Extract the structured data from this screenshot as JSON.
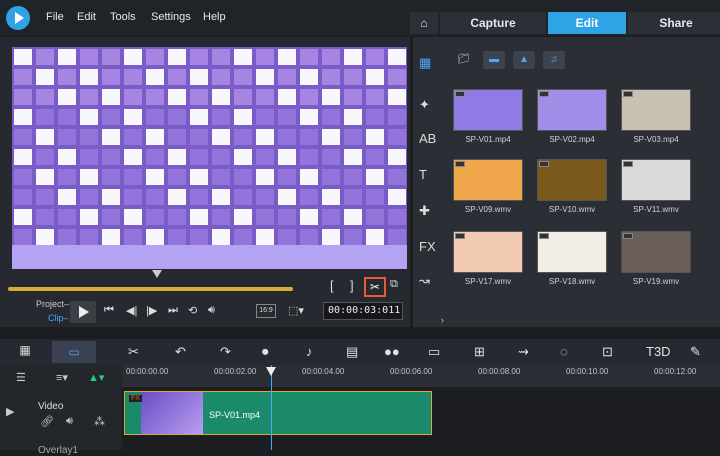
{
  "menu": [
    "File",
    "Edit",
    "Tools",
    "Settings",
    "Help"
  ],
  "tabs": [
    {
      "label": "Capture",
      "active": false
    },
    {
      "label": "Edit",
      "active": true
    },
    {
      "label": "Share",
      "active": false
    }
  ],
  "player": {
    "project_label": "Project–",
    "clip_label": "Clip–",
    "timecode": "00:00:03:011",
    "aspect_ratio": "16:9",
    "mark_in": "[",
    "mark_out": "]"
  },
  "library": {
    "items": [
      {
        "name": "SP-V01.mp4",
        "color": "#8f7be3"
      },
      {
        "name": "SP-V02.mp4",
        "color": "#a18ee8"
      },
      {
        "name": "SP-V03.mp4",
        "color": "#c8c0b0"
      },
      {
        "name": "SP-V09.wmv",
        "color": "#f0a64b"
      },
      {
        "name": "SP-V10.wmv",
        "color": "#7a5a1c"
      },
      {
        "name": "SP-V11.wmv",
        "color": "#d9d9d9"
      },
      {
        "name": "SP-V17.wmv",
        "color": "#f2c9b3"
      },
      {
        "name": "SP-V18.wmv",
        "color": "#f4efe6"
      },
      {
        "name": "SP-V19.wmv",
        "color": "#6a5e58"
      }
    ]
  },
  "ruler": {
    "ticks": [
      "00:00:00.00",
      "00:00:02.00",
      "00:00:04.00",
      "00:00:06.00",
      "00:00:08.00",
      "00:00:10.00",
      "00:00:12.00"
    ]
  },
  "tracks": {
    "video_label": "Video",
    "overlay_label": "Overlay1",
    "clip_name": "SP-V01.mp4",
    "clip_badge": "FX"
  },
  "colors": {
    "accent": "#2ea3e6",
    "clip": "#1a8a6b",
    "scrub": "#d9aa3a",
    "highlight": "#e85b3a"
  }
}
